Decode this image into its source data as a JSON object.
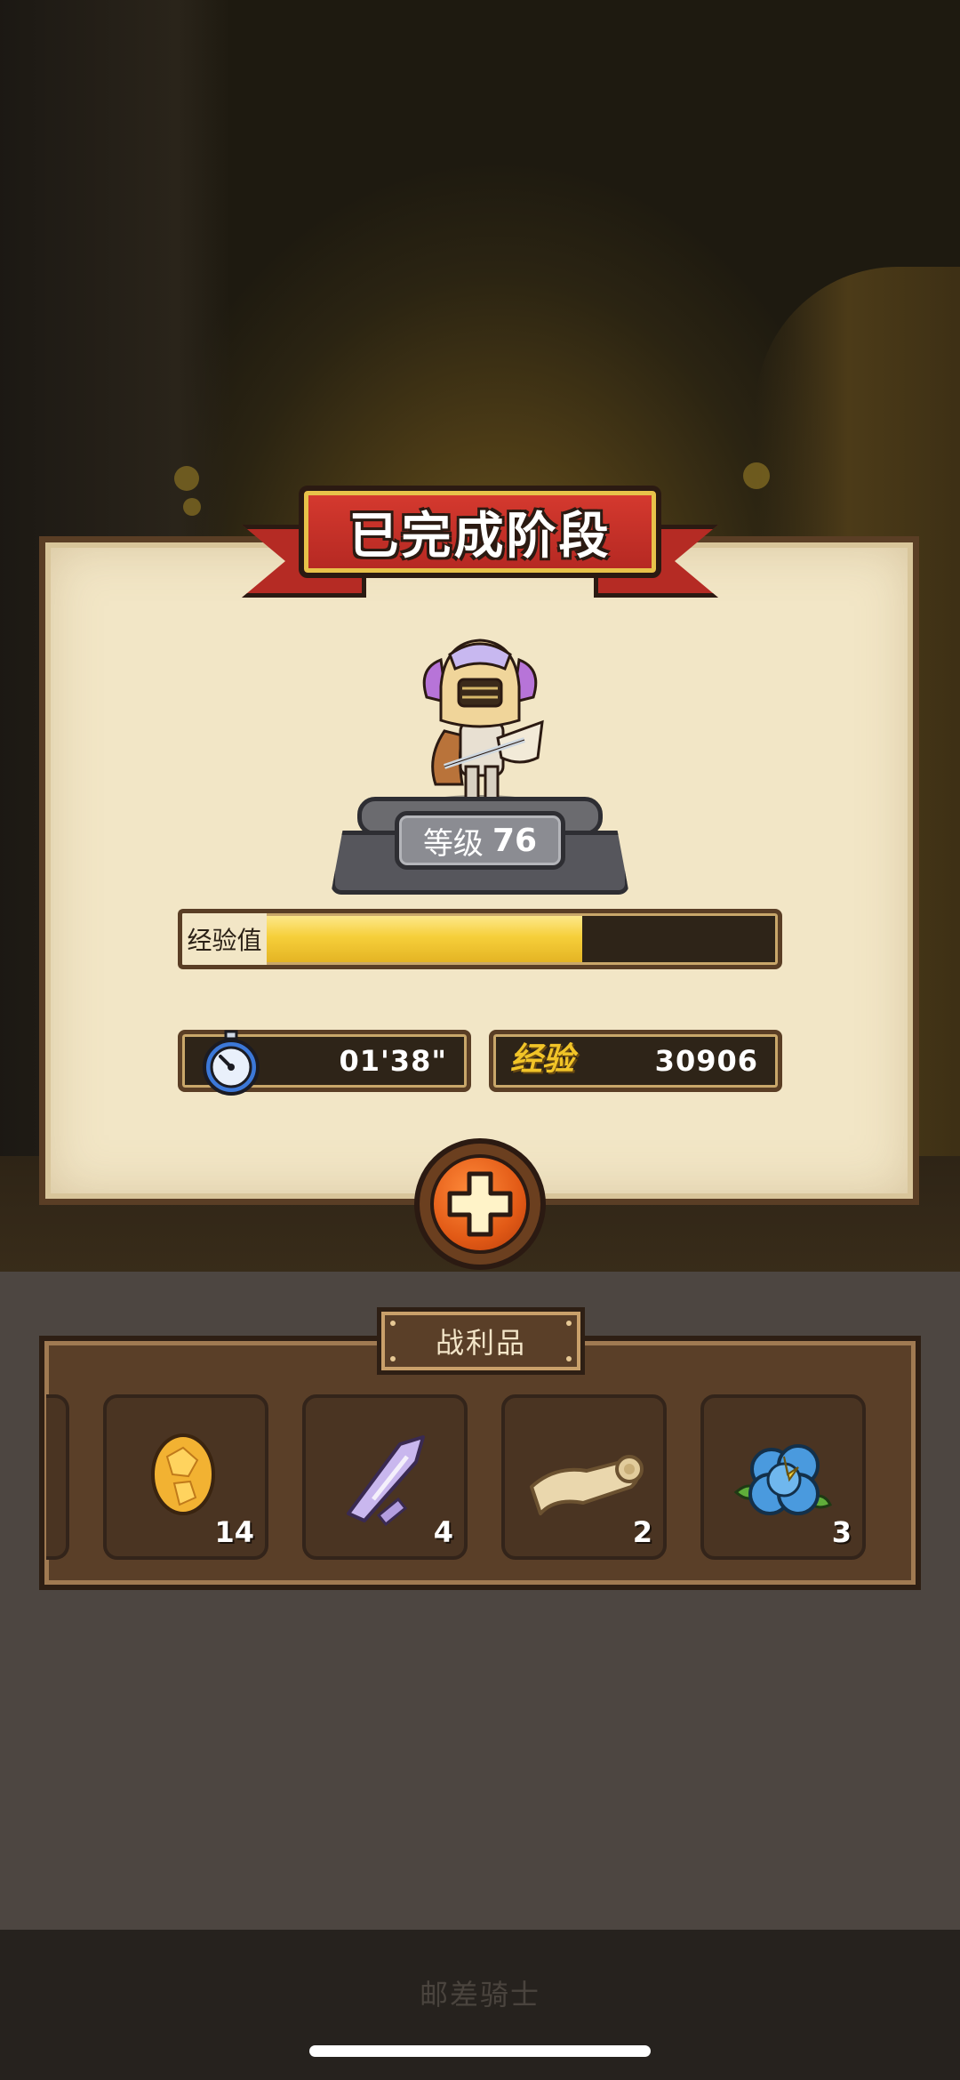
{
  "banner": {
    "title": "已完成阶段"
  },
  "hero": {
    "level_label": "等级",
    "level_value": "76"
  },
  "xp": {
    "label": "经验值",
    "progress": 0.62
  },
  "stats": {
    "time": "01'38\"",
    "exp_label": "经验",
    "exp_value": "30906"
  },
  "loot": {
    "title": "战利品",
    "items": [
      {
        "icon": "gold-egg-icon",
        "count": "14"
      },
      {
        "icon": "crystal-icon",
        "count": "4"
      },
      {
        "icon": "scroll-icon",
        "count": "2"
      },
      {
        "icon": "blue-flower-icon",
        "count": "3"
      }
    ]
  },
  "footer": {
    "label": "邮差骑士"
  },
  "colors": {
    "xp_fill": "#f6cf3a",
    "ribbon": "#c9302a",
    "plus_button": "#e25a16"
  }
}
